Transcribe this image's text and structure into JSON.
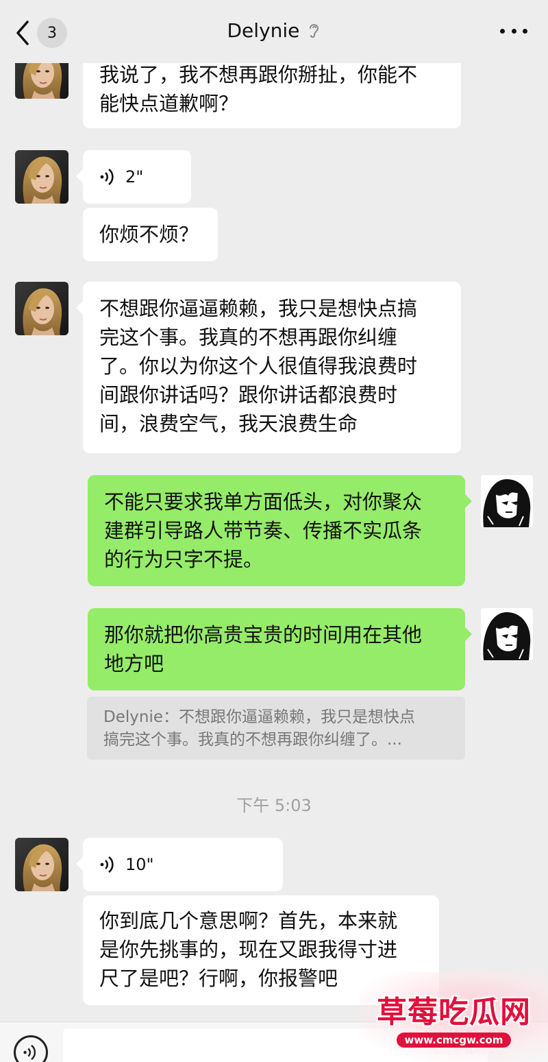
{
  "header": {
    "back_count": "3",
    "title": "Delynie",
    "ear_icon": "ear-icon",
    "more_icon": "more-dots-icon"
  },
  "messages": [
    {
      "from": "Delynie",
      "type": "text",
      "lines": [
        "我说了，我不想再跟你掰扯，你能不",
        "能快点道歉啊？"
      ]
    },
    {
      "from": "Delynie",
      "type": "voice",
      "duration": "2\""
    },
    {
      "from": "Delynie",
      "type": "text",
      "lines": [
        "你烦不烦？"
      ]
    },
    {
      "from": "Delynie",
      "type": "text",
      "lines": [
        "不想跟你逼逼赖赖，我只是想快点搞",
        "完这个事。我真的不想再跟你纠缠",
        "了。你以为你这个人很值得我浪费时",
        "间跟你讲话吗？跟你讲话都浪费时",
        "间，浪费空气，我天浪费生命"
      ]
    },
    {
      "from": "me",
      "type": "text",
      "lines": [
        "不能只要求我单方面低头，对你聚众",
        "建群引导路人带节奏、传播不实瓜条",
        "的行为只字不提。"
      ]
    },
    {
      "from": "me",
      "type": "text",
      "lines": [
        "那你就把你高贵宝贵的时间用在其他",
        "地方吧"
      ]
    },
    {
      "from": "me",
      "type": "quote",
      "lines": [
        "Delynie：不想跟你逼逼赖赖，我只是想快点",
        "搞完这个事。我真的不想再跟你纠缠了。..."
      ]
    },
    {
      "type": "timestamp",
      "text": "下午 5:03"
    },
    {
      "from": "Delynie",
      "type": "voice",
      "duration": "10\""
    },
    {
      "from": "Delynie",
      "type": "text",
      "lines": [
        "你到底几个意思啊？首先，本来就",
        "是你先挑事的，现在又跟我得寸进",
        "尺了是吧？行啊，你报警吧"
      ]
    }
  ],
  "bottom_bar": {
    "voice_icon": "voice-input-icon"
  },
  "watermark": {
    "text": "草莓吃瓜网",
    "url": "www.cmcgw.com"
  },
  "colors": {
    "background": "#ededed",
    "my_bubble": "#95ec69",
    "their_bubble": "#ffffff",
    "watermark": "#e0113c"
  }
}
